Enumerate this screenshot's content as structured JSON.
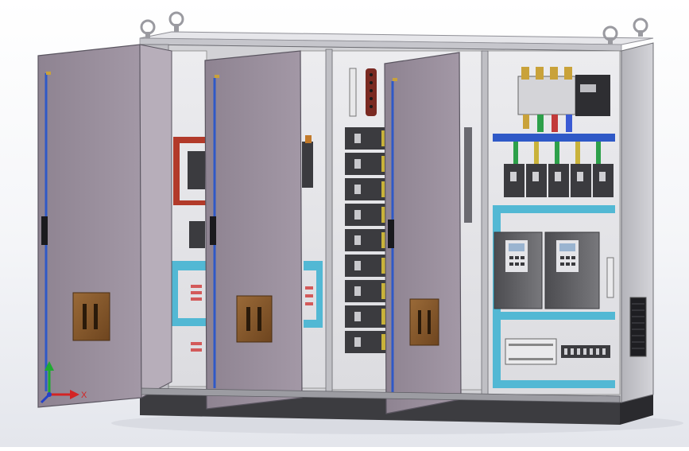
{
  "axis_triad": {
    "x_label": "X"
  },
  "colors": {
    "background": "#f4f5f8",
    "cabinet_body": "#cfcfd3",
    "door_panel": "#978c99",
    "plinth": "#3c3c40",
    "handle_bronze": "#8a5a2c",
    "busbar_blue": "#2f59c7",
    "duct_cyan": "#52b8d4",
    "breaker_dark": "#3b3b3f",
    "vfd_gray": "#5e5e62",
    "axis_x": "#d32424",
    "axis_y": "#1eaa32",
    "axis_z": "#2442c8"
  }
}
